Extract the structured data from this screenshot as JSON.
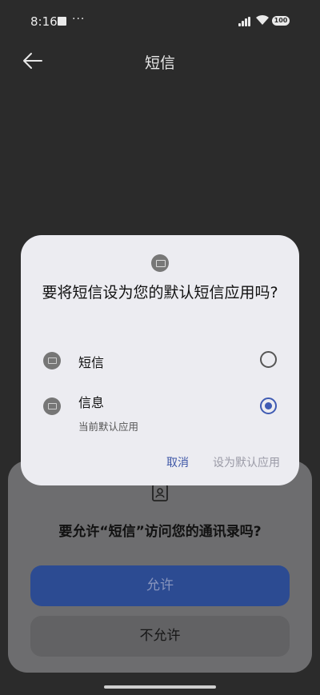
{
  "status": {
    "time": "8:16",
    "dots": "···",
    "battery": "100"
  },
  "appbar": {
    "title": "短信"
  },
  "dialog": {
    "title": "要将短信设为您的默认短信应用吗?",
    "options": [
      {
        "label": "短信",
        "sub": "",
        "selected": false
      },
      {
        "label": "信息",
        "sub": "当前默认应用",
        "selected": true
      }
    ],
    "cancel_label": "取消",
    "set_default_label": "设为默认应用"
  },
  "permission": {
    "title": "要允许“短信”访问您的通讯录吗?",
    "allow_label": "允许",
    "deny_label": "不允许"
  }
}
